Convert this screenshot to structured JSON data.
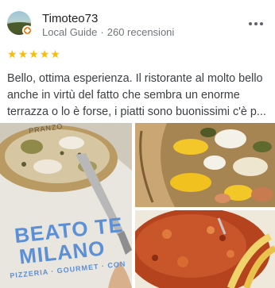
{
  "review": {
    "author_name": "Timoteo73",
    "author_badge": "Local Guide",
    "separator": "·",
    "review_count": "260 recensioni",
    "rating": 5,
    "star_glyph": "★",
    "text": "Bello, ottima esperienza. Il ristorante al molto bello anche in virtù del fatto che sembra un enorme terrazza o lo è forse, i piatti sono buonissimi c'è p...",
    "more_icon": "more-vertical-icon"
  },
  "photos": [
    {
      "description_name": "photo-pizza-menu",
      "menu_brand": "BEATO TE",
      "menu_city": "MILANO",
      "menu_sub": "PIZZERIA · GOURMET · CON",
      "corner_text": "PRANZO"
    },
    {
      "description_name": "photo-pizza-crust"
    },
    {
      "description_name": "photo-cutlet"
    }
  ],
  "colors": {
    "star": "#fbbc04",
    "badge": "#e8710a",
    "menu_blue": "#5b8fd6"
  }
}
